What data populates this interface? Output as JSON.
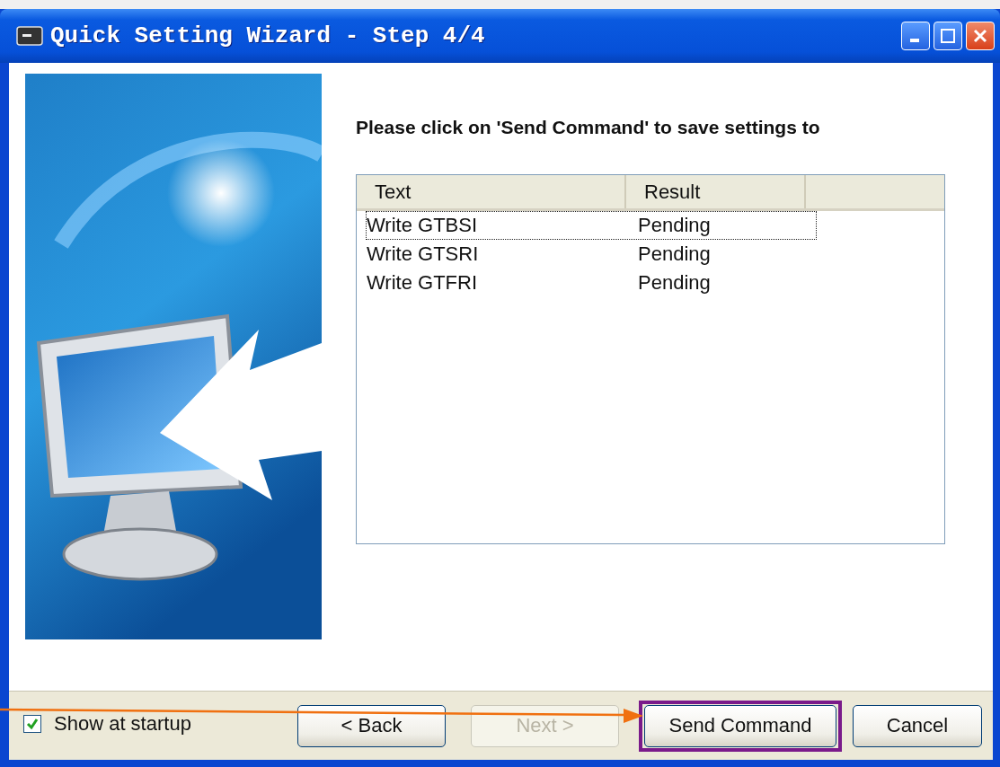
{
  "window": {
    "title": "Quick Setting Wizard - Step 4/4"
  },
  "instruction": "Please click on 'Send Command' to save settings to",
  "table": {
    "columns": [
      "Text",
      "Result"
    ],
    "rows": [
      {
        "text": "Write GTBSI",
        "result": "Pending",
        "focused": true
      },
      {
        "text": "Write GTSRI",
        "result": "Pending",
        "focused": false
      },
      {
        "text": "Write GTFRI",
        "result": "Pending",
        "focused": false
      }
    ]
  },
  "show_at_startup": {
    "label": "Show at startup",
    "checked": true
  },
  "buttons": [
    {
      "label": "< Back",
      "disabled": false,
      "highlighted": false
    },
    {
      "label": "Next >",
      "disabled": true,
      "highlighted": false
    },
    {
      "label": "Send Command",
      "disabled": false,
      "highlighted": true
    },
    {
      "label": "Cancel",
      "disabled": false,
      "highlighted": false
    }
  ]
}
